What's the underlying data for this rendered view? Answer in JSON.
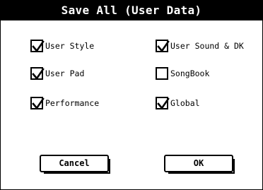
{
  "dialog": {
    "title": "Save All (User Data)"
  },
  "options": {
    "user_style": {
      "label": "User Style",
      "checked": true
    },
    "user_pad": {
      "label": "User Pad",
      "checked": true
    },
    "performance": {
      "label": "Performance",
      "checked": true
    },
    "user_sound_dk": {
      "label": "User Sound & DK",
      "checked": true
    },
    "songbook": {
      "label": "SongBook",
      "checked": false
    },
    "global": {
      "label": "Global",
      "checked": true
    }
  },
  "buttons": {
    "cancel_label": "Cancel",
    "ok_label": "OK"
  }
}
